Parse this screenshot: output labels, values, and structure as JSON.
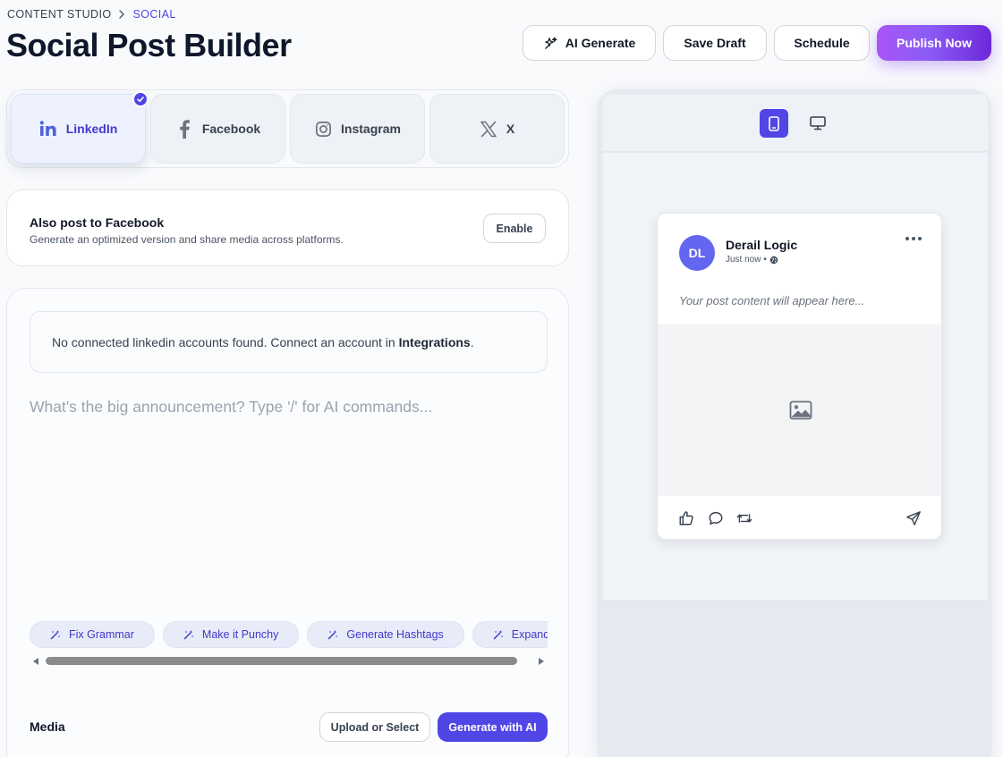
{
  "breadcrumb": {
    "root": "CONTENT STUDIO",
    "current": "SOCIAL"
  },
  "page_title": "Social Post Builder",
  "actions": {
    "ai_generate": "AI Generate",
    "save_draft": "Save Draft",
    "schedule": "Schedule",
    "publish_now": "Publish Now"
  },
  "platforms": [
    {
      "label": "LinkedIn",
      "icon": "linkedin-icon",
      "selected": true
    },
    {
      "label": "Facebook",
      "icon": "facebook-icon",
      "selected": false
    },
    {
      "label": "Instagram",
      "icon": "instagram-icon",
      "selected": false
    },
    {
      "label": "X",
      "icon": "x-icon",
      "selected": false
    }
  ],
  "also_post": {
    "title": "Also post to Facebook",
    "description": "Generate an optimized version and share media across platforms.",
    "button": "Enable"
  },
  "editor": {
    "notice_prefix": "No connected linkedin accounts found. Connect an account in ",
    "notice_link": "Integrations",
    "notice_suffix": ".",
    "placeholder": "What's the big announcement? Type '/' for AI commands...",
    "chips": [
      "Fix Grammar",
      "Make it Punchy",
      "Generate Hashtags",
      "Expand"
    ]
  },
  "media": {
    "label": "Media",
    "upload_button": "Upload or Select",
    "generate_button": "Generate with AI"
  },
  "preview": {
    "active_device": "mobile",
    "author_initials": "DL",
    "author_name": "Derail Logic",
    "time": "Just now •",
    "content_placeholder": "Your post content will appear here..."
  },
  "colors": {
    "accent": "#4f46e5",
    "publish_gradient_start": "#a855f7",
    "publish_gradient_end": "#6d28d9",
    "avatar": "#6366f1"
  }
}
